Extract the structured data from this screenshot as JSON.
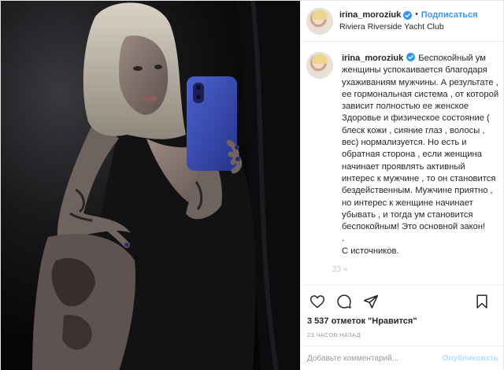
{
  "post": {
    "username": "irina_moroziuk",
    "follow_label": "Подписаться",
    "dot": "•",
    "location": "Riviera Riverside Yacht Club"
  },
  "caption": {
    "username": "irina_moroziuk",
    "text": "Беспокойный ум женщины успокаивается благодаря ухаживаниям мужчины. А результате , ее гормональная система , от которой зависит полностью ее женское Здоровье и физическое состояние ( блеск кожи , сияние глаз , волосы , вес) нормализуется. Но есть и обратная сторона , если женщина начинает проявлять активный интерес к мужчине , то он становится бездейственным. Мужчине приятно , но интерес к женщине начинает убывать , и тогда ум становится беспокойным! Это основной закон!\n.\nС источников.",
    "time": "23 ч"
  },
  "likes": "3 537 отметок \"Нравится\"",
  "time_ago": "23 ЧАСОВ НАЗАД",
  "comment_box": {
    "placeholder": "Добавьте комментарий...",
    "publish_label": "Опубликовать"
  },
  "icons": {
    "verified": "verified-badge-icon",
    "like": "heart-icon",
    "comment": "comment-icon",
    "share": "share-icon",
    "save": "bookmark-icon"
  },
  "colors": {
    "accent": "#3897f0",
    "publish_disabled": "#b2dffc",
    "phone_case": "#3a4fb8"
  }
}
